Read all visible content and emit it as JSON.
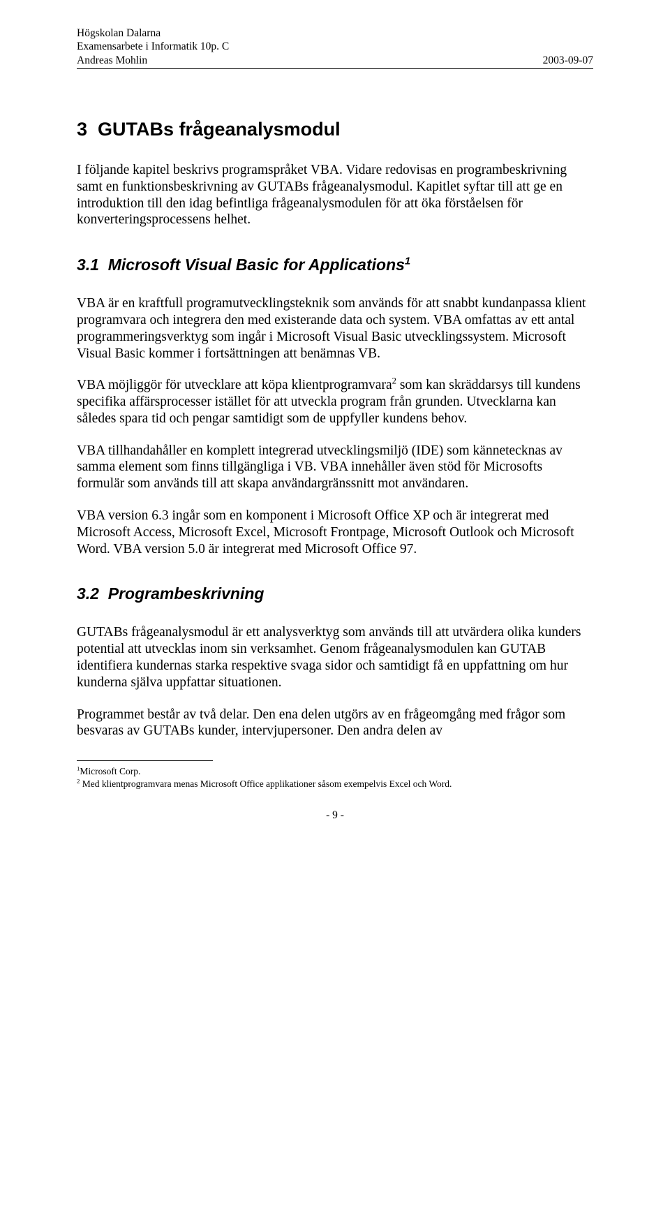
{
  "header": {
    "line1": "Högskolan Dalarna",
    "line2": "Examensarbete i Informatik 10p. C",
    "line3": "Andreas Mohlin",
    "date": "2003-09-07"
  },
  "h1": "3  GUTABs frågeanalysmodul",
  "p1": "I följande kapitel beskrivs programspråket VBA. Vidare redovisas en programbeskrivning samt en funktionsbeskrivning av GUTABs frågeanalysmodul. Kapitlet syftar till att ge en introduktion till den idag befintliga frågeanalysmodulen för att öka förståelsen för konverteringsprocessens helhet.",
  "h2a_prefix": "3.1  Microsoft Visual Basic for Applications",
  "h2a_sup": "1",
  "p2": "VBA är en kraftfull programutvecklingsteknik som används för att snabbt kundanpassa klient programvara och integrera den med existerande data och system. VBA omfattas av ett antal programmeringsverktyg som ingår i Microsoft Visual Basic utvecklingssystem. Microsoft Visual Basic kommer i fortsättningen att benämnas VB.",
  "p3a": "VBA möjliggör för utvecklare att köpa klientprogramvara",
  "p3sup": "2",
  "p3b": " som kan skräddarsys till kundens specifika affärsprocesser istället för att utveckla program från grunden. Utvecklarna kan således spara tid och pengar samtidigt som de uppfyller kundens behov.",
  "p4": "VBA tillhandahåller en komplett integrerad utvecklingsmiljö (IDE) som kännetecknas av samma element som finns tillgängliga i VB. VBA innehåller även stöd för Microsofts formulär som används till att skapa användargränssnitt mot användaren.",
  "p5": "VBA version 6.3 ingår som en komponent i Microsoft Office XP och är integrerat med Microsoft Access, Microsoft Excel, Microsoft Frontpage, Microsoft Outlook och Microsoft Word. VBA version 5.0 är integrerat med Microsoft Office 97.",
  "h2b": "3.2  Programbeskrivning",
  "p6": "GUTABs frågeanalysmodul är ett analysverktyg som används till att utvärdera olika kunders potential att utvecklas inom sin verksamhet. Genom frågeanalysmodulen kan GUTAB identifiera kundernas starka respektive svaga sidor och samtidigt få en uppfattning om hur kunderna själva uppfattar situationen.",
  "p7": "Programmet består av två delar. Den ena delen utgörs av en frågeomgång med frågor som besvaras av GUTABs kunder, intervjupersoner. Den andra delen av",
  "fn1_sup": "1",
  "fn1": "Microsoft Corp.",
  "fn2_sup": "2",
  "fn2": " Med klientprogramvara menas Microsoft Office applikationer såsom exempelvis Excel och Word.",
  "pagenum": "- 9 -"
}
